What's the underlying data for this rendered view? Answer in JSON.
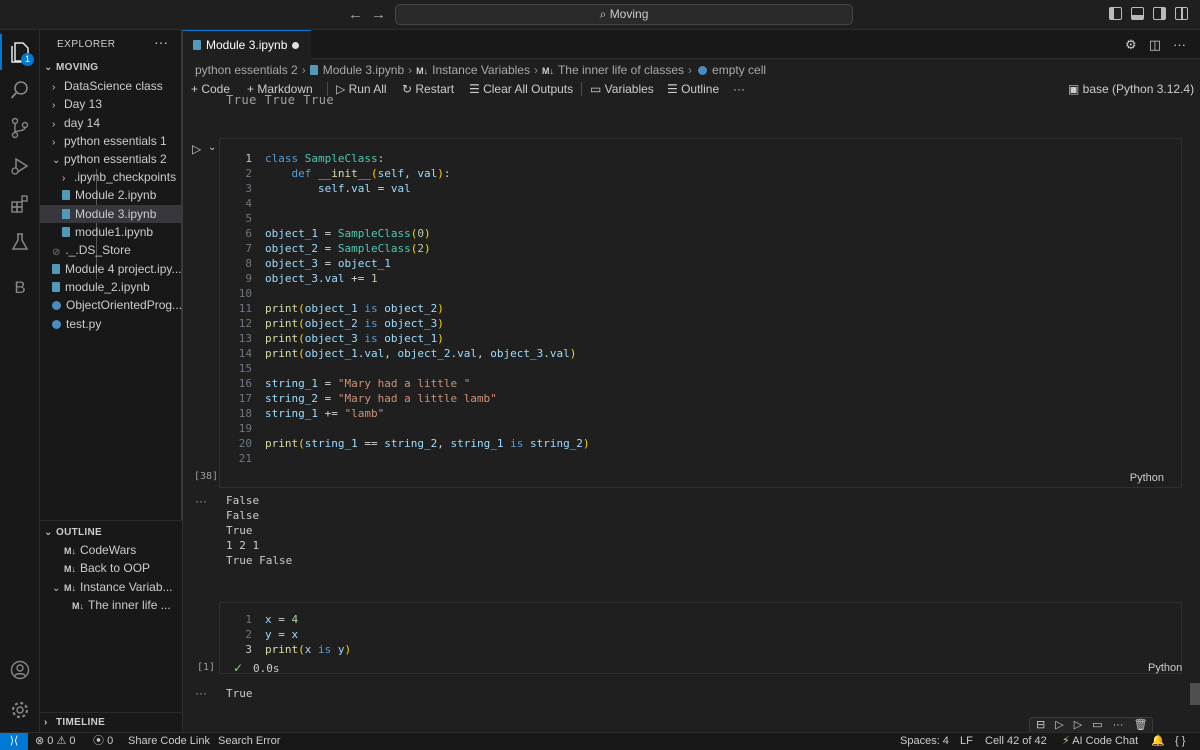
{
  "titlebar": {
    "back": "←",
    "forward": "→",
    "search_text": "Moving"
  },
  "activity": {
    "badge": "1",
    "b_label": "B"
  },
  "explorer": {
    "title": "EXPLORER",
    "more": "···",
    "root": "MOVING",
    "items": [
      {
        "label": "DataScience class",
        "type": "folder",
        "expanded": false
      },
      {
        "label": "Day 13",
        "type": "folder",
        "expanded": false
      },
      {
        "label": "day 14",
        "type": "folder",
        "expanded": false
      },
      {
        "label": "python essentials 1",
        "type": "folder",
        "expanded": false
      },
      {
        "label": "python essentials 2",
        "type": "folder",
        "expanded": true
      },
      {
        "label": ".ipynb_checkpoints",
        "type": "folder",
        "expanded": false
      },
      {
        "label": "Module 2.ipynb",
        "type": "notebook"
      },
      {
        "label": "Module 3.ipynb",
        "type": "notebook",
        "selected": true
      },
      {
        "label": "module1.ipynb",
        "type": "notebook"
      },
      {
        "label": "._.DS_Store",
        "type": "dsstore"
      },
      {
        "label": "Module 4 project.ipy...",
        "type": "notebook"
      },
      {
        "label": "module_2.ipynb",
        "type": "notebook"
      },
      {
        "label": "ObjectOrientedProg...",
        "type": "python"
      },
      {
        "label": "test.py",
        "type": "python"
      }
    ]
  },
  "outline": {
    "title": "OUTLINE",
    "md_badge": "M↓",
    "items": [
      {
        "label": "CodeWars"
      },
      {
        "label": "Back to OOP"
      },
      {
        "label": "Instance Variab..."
      },
      {
        "label": "The inner life ..."
      }
    ]
  },
  "timeline": {
    "title": "TIMELINE"
  },
  "tab": {
    "label": "Module 3.ipynb"
  },
  "breadcrumb": {
    "parts": [
      "python essentials 2",
      "Module 3.ipynb",
      "Instance Variables",
      "The inner life of classes",
      "empty cell"
    ],
    "md_badge": "M↓"
  },
  "toolbar": {
    "code": "Code",
    "markdown": "Markdown",
    "run_all": "Run All",
    "restart": "Restart",
    "clear_outputs": "Clear All Outputs",
    "variables": "Variables",
    "outline": "Outline",
    "more": "···",
    "kernel": "base (Python 3.12.4)"
  },
  "prev_output": "True   True   True",
  "cell1": {
    "exec_count": "[38]",
    "language": "Python",
    "line_numbers": [
      "1",
      "2",
      "3",
      "4",
      "5",
      "6",
      "7",
      "8",
      "9",
      "10",
      "11",
      "12",
      "13",
      "14",
      "15",
      "16",
      "17",
      "18",
      "19",
      "20",
      "21"
    ],
    "output_lines": [
      "False",
      "False",
      "True",
      "1 2 1",
      "True False"
    ],
    "output_ellipsis": "···"
  },
  "cell2": {
    "exec_count": "[1]",
    "language": "Python",
    "time": "0.0s",
    "line_numbers": [
      "1",
      "2",
      "3"
    ],
    "output_lines": [
      "True"
    ],
    "output_ellipsis": "···"
  },
  "statusbar": {
    "errors": "0",
    "warnings": "0",
    "ports": "0",
    "share": "Share Code Link",
    "search_error": "Search Error",
    "spaces": "Spaces: 4",
    "eol": "LF",
    "cell": "Cell 42 of 42",
    "ai_chat": "AI Code Chat",
    "braces": "{ }"
  },
  "colors": {
    "accent": "#0078d4",
    "background": "#1f1f1f",
    "sidebar": "#181818"
  }
}
